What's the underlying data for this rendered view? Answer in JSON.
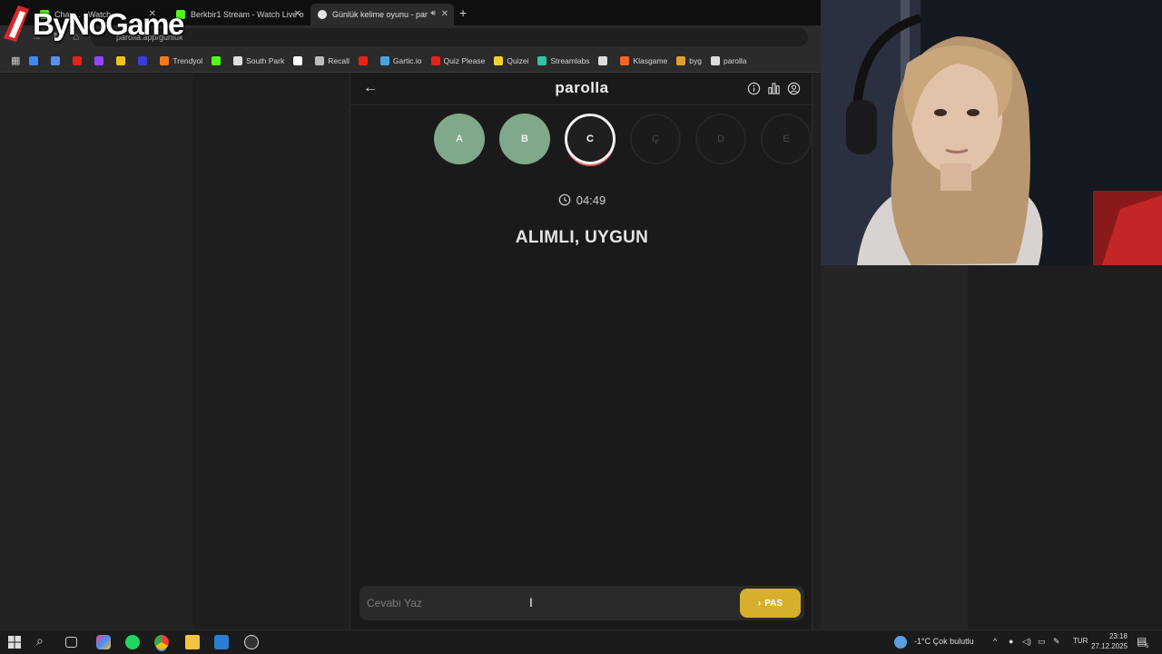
{
  "browser": {
    "tabs": [
      {
        "title": "Chan... - Watch",
        "favicon_color": "#53fc18"
      },
      {
        "title": "Berkbir1 Stream - Watch Live o",
        "favicon_color": "#53fc18"
      },
      {
        "title": "Günlük kelime oyunu - par",
        "favicon_color": "#e6e6e6"
      }
    ],
    "url": "parolla.app/gunluk",
    "bookmarks": [
      {
        "label": "",
        "icon": "google-icon",
        "color": "#4285f4"
      },
      {
        "label": "",
        "icon": "translate-icon",
        "color": "#5b8def"
      },
      {
        "label": "",
        "icon": "youtube-icon",
        "color": "#e62117"
      },
      {
        "label": "",
        "icon": "twitch-icon",
        "color": "#9146ff"
      },
      {
        "label": "",
        "icon": "folder-icon",
        "color": "#f0c419"
      },
      {
        "label": "",
        "icon": "bookmark-icon",
        "color": "#3b3bd6"
      },
      {
        "label": "Trendyol",
        "icon": "trendyol-icon",
        "color": "#f27a1a"
      },
      {
        "label": "",
        "icon": "kick-icon",
        "color": "#53fc18"
      },
      {
        "label": "South Park",
        "icon": "globe-icon",
        "color": "#dddddd"
      },
      {
        "label": "",
        "icon": "x-icon",
        "color": "#ffffff"
      },
      {
        "label": "Recall",
        "icon": "recall-icon",
        "color": "#bbbbbb"
      },
      {
        "label": "",
        "icon": "youtube-icon",
        "color": "#e62117"
      },
      {
        "label": "Gartic.io",
        "icon": "gartic-icon",
        "color": "#4aa3df"
      },
      {
        "label": "Quiz Please",
        "icon": "youtube-icon",
        "color": "#e62117"
      },
      {
        "label": "Quizei",
        "icon": "quizei-icon",
        "color": "#f5d033"
      },
      {
        "label": "Streamlabs",
        "icon": "streamlabs-icon",
        "color": "#31c3a2"
      },
      {
        "label": "",
        "icon": "globe-icon",
        "color": "#dddddd"
      },
      {
        "label": "Klasgame",
        "icon": "klasgame-icon",
        "color": "#f26522"
      },
      {
        "label": "byg",
        "icon": "byg-icon",
        "color": "#e0a030"
      },
      {
        "label": "parolla",
        "icon": "parolla-icon",
        "color": "#dddddd"
      }
    ]
  },
  "logo": {
    "text": "ByNoGame"
  },
  "game": {
    "title": "parolla",
    "letters": [
      {
        "letter": "A",
        "state": "correct"
      },
      {
        "letter": "B",
        "state": "correct"
      },
      {
        "letter": "C",
        "state": "current"
      },
      {
        "letter": "Ç",
        "state": "pending"
      },
      {
        "letter": "D",
        "state": "pending"
      },
      {
        "letter": "E",
        "state": "pending"
      }
    ],
    "timer": "04:49",
    "clue": "ALIMLI, UYGUN",
    "answer_placeholder": "Cevabı Yaz",
    "pass_label": "PAS"
  },
  "taskbar": {
    "weather": "-1°C  Çok bulutlu",
    "lang": "TUR",
    "time": "23:18",
    "date": "27.12.2025",
    "notif_count": "5"
  },
  "colors": {
    "correct": "#7fa98a",
    "pass_button": "#d6b02c",
    "current_ring": "#f2f2f2",
    "current_accent": "#e05a5a"
  }
}
